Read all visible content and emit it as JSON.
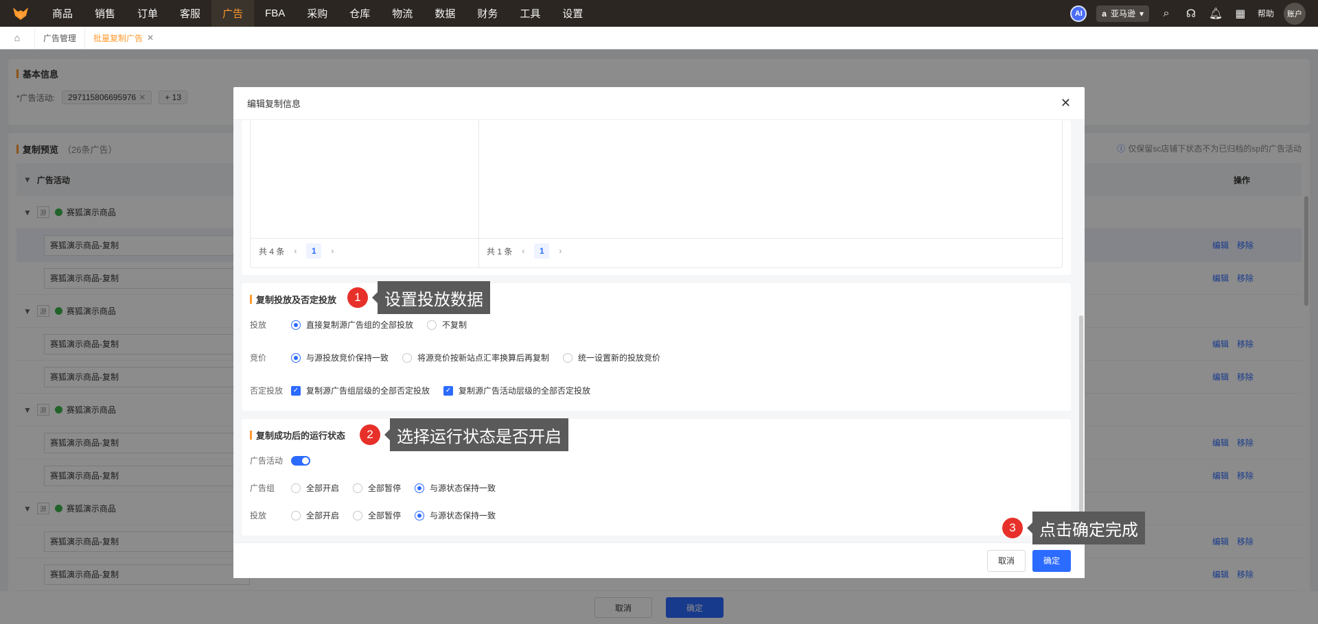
{
  "topbar": {
    "nav": [
      "商品",
      "销售",
      "订单",
      "客服",
      "广告",
      "FBA",
      "采购",
      "仓库",
      "物流",
      "数据",
      "财务",
      "工具",
      "设置"
    ],
    "active_nav": "广告",
    "ai_label": "AI",
    "store_label": "亚马逊",
    "help_label": "帮助",
    "avatar_label": "账户"
  },
  "tabs": {
    "items": [
      "广告管理",
      "批量复制广告"
    ],
    "active": "批量复制广告"
  },
  "basic_info": {
    "title": "基本信息",
    "campaign_label": "*广告活动:",
    "campaign_tag": "297115806695976",
    "more_tag": "+ 13"
  },
  "preview": {
    "title": "复制预览",
    "count": "（26条广告）",
    "notice": "仅保留sc店铺下状态不为已归档的sp的广告活动",
    "col_campaign": "广告活动",
    "col_ops": "操作",
    "source_badge": "源",
    "rows": [
      {
        "type": "src",
        "name": "赛狐演示商品"
      },
      {
        "type": "copy",
        "name": "赛狐演示商品-复制",
        "edit": "编辑",
        "remove": "移除"
      },
      {
        "type": "copy",
        "name": "赛狐演示商品-复制",
        "edit": "编辑",
        "remove": "移除"
      },
      {
        "type": "src",
        "name": "赛狐演示商品"
      },
      {
        "type": "copy",
        "name": "赛狐演示商品-复制",
        "edit": "编辑",
        "remove": "移除"
      },
      {
        "type": "copy",
        "name": "赛狐演示商品-复制",
        "edit": "编辑",
        "remove": "移除"
      },
      {
        "type": "src",
        "name": "赛狐演示商品"
      },
      {
        "type": "copy",
        "name": "赛狐演示商品-复制",
        "edit": "编辑",
        "remove": "移除"
      },
      {
        "type": "copy",
        "name": "赛狐演示商品-复制",
        "edit": "编辑",
        "remove": "移除"
      },
      {
        "type": "src",
        "name": "赛狐演示商品"
      },
      {
        "type": "copy",
        "name": "赛狐演示商品-复制",
        "edit": "编辑",
        "remove": "移除"
      },
      {
        "type": "copy",
        "name": "赛狐演示商品-复制",
        "edit": "编辑",
        "remove": "移除"
      }
    ]
  },
  "page_footer": {
    "cancel": "取消",
    "ok": "确定"
  },
  "modal": {
    "title": "编辑复制信息",
    "left_pager_total": "共 4 条",
    "right_pager_total": "共 1 条",
    "page_current": "1",
    "targeting": {
      "title": "复制投放及否定投放",
      "row1_label": "投放",
      "row1_opt1": "直接复制源广告组的全部投放",
      "row1_opt2": "不复制",
      "row2_label": "竞价",
      "row2_opt1": "与源投放竞价保持一致",
      "row2_opt2": "将源竞价按新站点汇率换算后再复制",
      "row2_opt3": "统一设置新的投放竞价",
      "row3_label": "否定投放",
      "row3_chk1": "复制源广告组层级的全部否定投放",
      "row3_chk2": "复制源广告活动层级的全部否定投放"
    },
    "status": {
      "title": "复制成功后的运行状态",
      "campaign_label": "广告活动",
      "adgroup_label": "广告组",
      "target_label": "投放",
      "opt_all_on": "全部开启",
      "opt_all_off": "全部暂停",
      "opt_same": "与源状态保持一致"
    },
    "cancel": "取消",
    "ok": "确定"
  },
  "callouts": {
    "c1_num": "1",
    "c1_text": "设置投放数据",
    "c2_num": "2",
    "c2_text": "选择运行状态是否开启",
    "c3_num": "3",
    "c3_text": "点击确定完成"
  },
  "colors": {
    "accent": "#ff9a2e",
    "primary": "#2c6bff",
    "callout": "#e8302a"
  }
}
